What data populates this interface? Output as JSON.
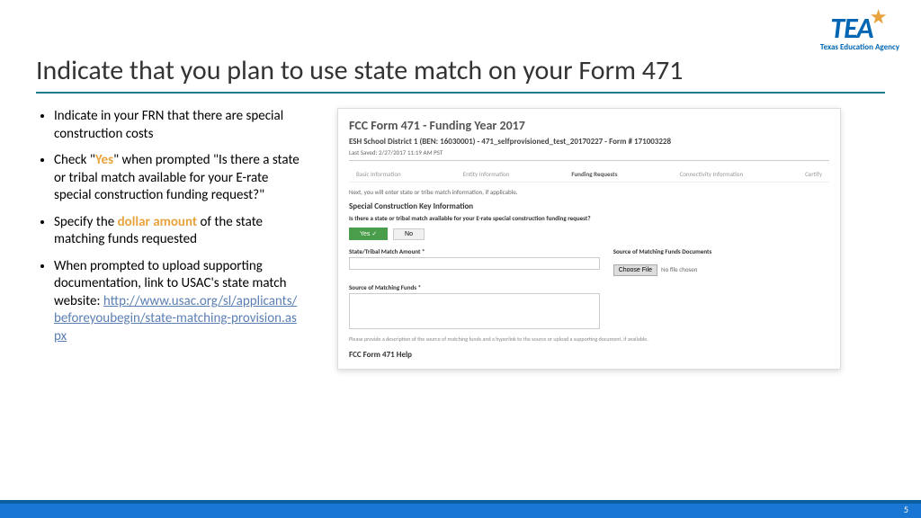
{
  "logo": {
    "text": "TEA",
    "sub": "Texas Education Agency"
  },
  "title": "Indicate that you plan to use state match on your Form 471",
  "bullets": {
    "b1": "Indicate in your FRN that there are special construction costs",
    "b2_pre": "Check \"",
    "b2_hl": "Yes",
    "b2_post": "\" when prompted \"Is there a state or tribal match available for your E-rate special construction funding request?\"",
    "b3_pre": "Specify the ",
    "b3_hl": "dollar amount",
    "b3_post": " of the state matching funds requested",
    "b4": "When prompted to upload supporting documentation, link to USAC's state match website: ",
    "b4_link": "http://www.usac.org/sl/applicants/beforeyoubegin/state-matching-provision.aspx"
  },
  "form": {
    "title": "FCC Form 471 - Funding Year 2017",
    "sub": "ESH School District 1 (BEN: 16030001) - 471_selfprovisioned_test_20170227 - Form # 171003228",
    "saved": "Last Saved: 2/27/2017 11:19 AM PST",
    "tabs": {
      "t1": "Basic Information",
      "t2": "Entity Information",
      "t3": "Funding Requests",
      "t4": "Connectivity Information",
      "t5": "Certify"
    },
    "note": "Next, you will enter state or tribe match information, if applicable.",
    "section": "Special Construction Key Information",
    "question": "Is there a state or tribal match available for your E-rate special construction funding request?",
    "yes": "Yes ✓",
    "no": "No",
    "amount_lbl": "State/Tribal Match Amount *",
    "source_lbl": "Source of Matching Funds *",
    "docs_lbl": "Source of Matching Funds Documents",
    "choose": "Choose File",
    "nofile": "No file chosen",
    "hint": "Please provide a description of the source of matching funds and a hyperlink to the source or upload a supporting document, if available.",
    "help": "FCC Form 471 Help"
  },
  "pagenum": "5"
}
